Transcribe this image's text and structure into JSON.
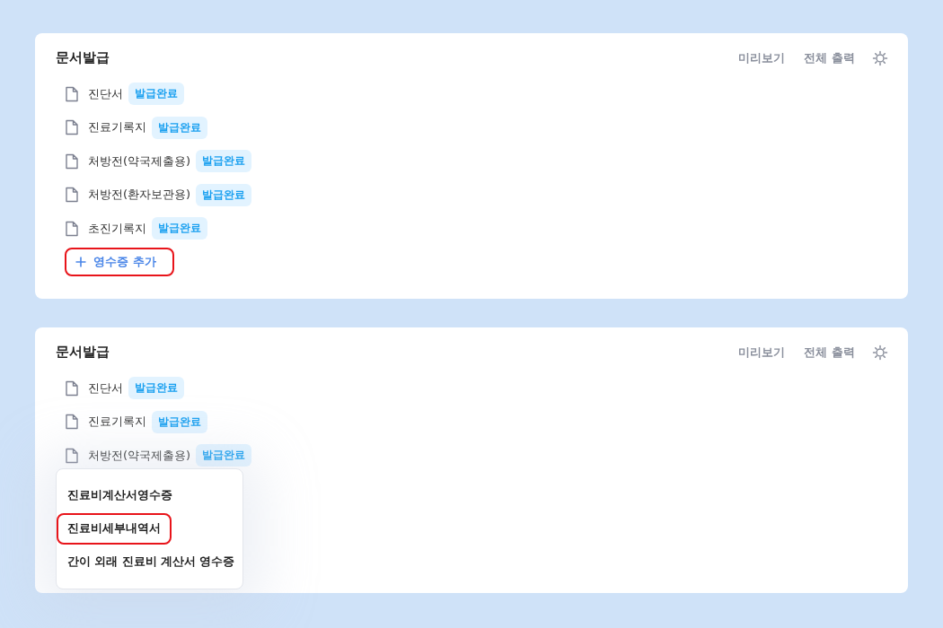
{
  "panels": [
    {
      "title": "문서발급",
      "actions": [
        "미리보기",
        "전체 출력"
      ],
      "documents": [
        {
          "name": "진단서",
          "status": "발급완료"
        },
        {
          "name": "진료기록지",
          "status": "발급완료"
        },
        {
          "name": "처방전(약국제출용)",
          "status": "발급완료"
        },
        {
          "name": "처방전(환자보관용)",
          "status": "발급완료"
        },
        {
          "name": "초진기록지",
          "status": "발급완료"
        }
      ],
      "add_button": {
        "label": "영수증 추가",
        "highlighted": true
      }
    },
    {
      "title": "문서발급",
      "actions": [
        "미리보기",
        "전체 출력"
      ],
      "documents": [
        {
          "name": "진단서",
          "status": "발급완료"
        },
        {
          "name": "진료기록지",
          "status": "발급완료"
        },
        {
          "name": "처방전(약국제출용)",
          "status": "발급완료"
        }
      ],
      "menu": [
        {
          "label": "진료비계산서영수증",
          "highlighted": false
        },
        {
          "label": "진료비세부내역서",
          "highlighted": true
        },
        {
          "label": "간이 외래 진료비 계산서 영수증",
          "highlighted": false
        }
      ]
    }
  ]
}
